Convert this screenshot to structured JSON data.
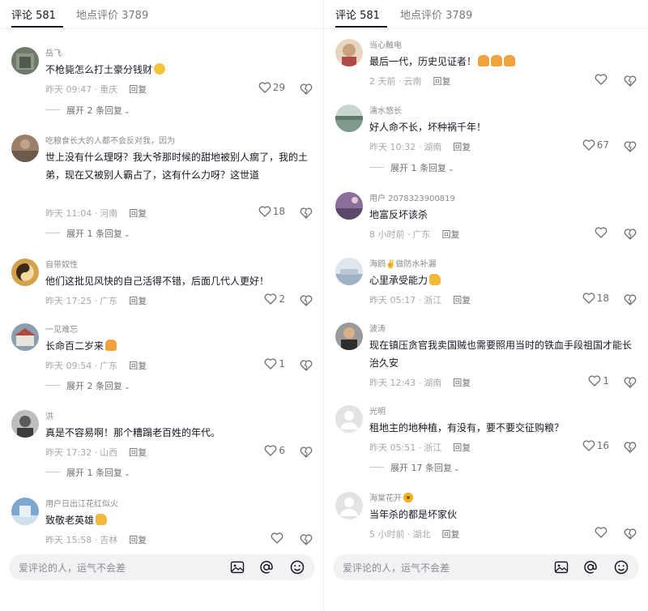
{
  "left": {
    "tabs": [
      {
        "label": "评论 581",
        "active": true
      },
      {
        "label": "地点评价 3789",
        "active": false
      }
    ],
    "comments": [
      {
        "username": "岳飞",
        "text": "不枪毙怎么打土豪分钱财",
        "emoji": "smile",
        "time": "昨天 09:47",
        "location": "重庆",
        "reply": "回复",
        "likes": "29",
        "expand": "展开 2 条回复",
        "avatar_color": "#6f7a6a"
      },
      {
        "username": "吃粮食长大的人都不会反对我，因为",
        "text": "世上没有什么理呀？我大爷那时候的甜地被别人瘸了，我的土弟，现在又被别人霸占了，这有什么力呀？这世道",
        "emoji": "",
        "time": "昨天 11:04",
        "location": "河南",
        "reply": "回复",
        "likes": "18",
        "expand": "展开 1 条回复",
        "avatar_color": "#9a7f6a"
      },
      {
        "username": "自带奴性",
        "text": "他们这批见风快的自己活得不错，后面几代人更好！",
        "emoji": "",
        "time": "昨天 17:25",
        "location": "广东",
        "reply": "回复",
        "likes": "2",
        "expand": "",
        "avatar_color": "#d4a24a"
      },
      {
        "username": "一见难忘",
        "text": "长命百二岁来",
        "emoji": "pray",
        "time": "昨天 09:54",
        "location": "广东",
        "reply": "回复",
        "likes": "1",
        "expand": "展开 2 条回复",
        "avatar_color": "#8c9fb2"
      },
      {
        "username": "洪",
        "text": "真是不容易啊！那个糟蹋老百姓的年代。",
        "emoji": "",
        "time": "昨天 17:32",
        "location": "山西",
        "reply": "回复",
        "likes": "6",
        "expand": "展开 1 条回复",
        "avatar_color": "#5a5a5a"
      },
      {
        "username": "用户日出江花红似火",
        "text": "致敬老英雄",
        "emoji": "thumb",
        "time": "昨天 15:58",
        "location": "吉林",
        "reply": "回复",
        "likes": "",
        "expand": "",
        "avatar_color": "#7ea7cf"
      }
    ],
    "input_placeholder": "爱评论的人，运气不会差"
  },
  "right": {
    "tabs": [
      {
        "label": "评论 581",
        "active": true
      },
      {
        "label": "地点评价 3789",
        "active": false
      }
    ],
    "comments": [
      {
        "username": "当心触电",
        "text": "最后一代，历史见证者！",
        "emoji": "pray3",
        "time": "2 天前",
        "location": "云南",
        "reply": "回复",
        "likes": "",
        "expand": "",
        "avatar_color": "#c8a27a"
      },
      {
        "username": "濡水悠长",
        "text": "好人命不长，坏种祸千年！",
        "emoji": "",
        "time": "昨天 10:32",
        "location": "湖南",
        "reply": "回复",
        "likes": "67",
        "expand": "展开 1 条回复",
        "avatar_color": "#7d9a8a"
      },
      {
        "username": "用户 2078323900819",
        "text": "地富反坏该杀",
        "emoji": "",
        "time": "8 小时前",
        "location": "广东",
        "reply": "回复",
        "likes": "",
        "expand": "",
        "avatar_color": "#8b6f9a"
      },
      {
        "username": "海鸥✌️做防水补漏",
        "text": "心里承受能力",
        "emoji": "thumb",
        "time": "昨天 05:17",
        "location": "浙江",
        "reply": "回复",
        "likes": "18",
        "expand": "",
        "avatar_color": "#9fb3c4"
      },
      {
        "username": "波涛",
        "text": "现在镇压贪官我卖国贼也需要照用当时的铁血手段祖国才能长治久安",
        "emoji": "",
        "time": "昨天 12:43",
        "location": "湖南",
        "reply": "回复",
        "likes": "1",
        "expand": "",
        "avatar_color": "#4a4a4a"
      },
      {
        "username": "光明",
        "text": "租地主的地种植，有没有，要不要交征购粮？",
        "emoji": "",
        "time": "昨天 05:51",
        "location": "浙江",
        "reply": "回复",
        "likes": "16",
        "expand": "展开 17 条回复",
        "avatar_color": "#d6d6d8"
      },
      {
        "username": "海棠花开",
        "text": "当年杀的都是坏家伙",
        "emoji": "",
        "time": "5 小时前",
        "location": "湖北",
        "reply": "回复",
        "likes": "",
        "expand": "",
        "avatar_color": "#d6d6d8"
      }
    ],
    "input_placeholder": "爱评论的人，运气不会差"
  },
  "colors": {
    "text": "#161823",
    "muted": "#a7a8ad",
    "tab_muted": "#7a7a7a",
    "input_bg": "#f2f2f4"
  },
  "icons": [
    "heart-icon",
    "dislike-heart-icon",
    "image-icon",
    "at-icon",
    "emoji-icon",
    "chevron-down-icon"
  ]
}
